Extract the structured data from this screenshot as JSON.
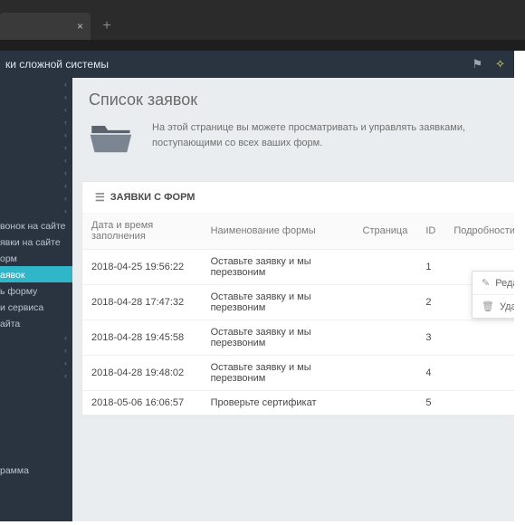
{
  "header": {
    "title": "ки сложной системы"
  },
  "page": {
    "title": "Список заявок",
    "info": "На этой странице вы можете просматривать и управлять заявками, поступающими со всех ваших форм."
  },
  "panel": {
    "title": "ЗАЯВКИ С ФОРМ"
  },
  "table": {
    "columns": {
      "datetime": "Дата и время заполнения",
      "form_name": "Наименование формы",
      "page": "Страница",
      "id": "ID",
      "details": "Подробности"
    },
    "rows": [
      {
        "datetime": "2018-04-25 19:56:22",
        "form_name": "Оставьте заявку и мы перезвоним",
        "page": "",
        "id": "1"
      },
      {
        "datetime": "2018-04-28 17:47:32",
        "form_name": "Оставьте заявку и мы перезвоним",
        "page": "",
        "id": "2"
      },
      {
        "datetime": "2018-04-28 19:45:58",
        "form_name": "Оставьте заявку и мы перезвоним",
        "page": "",
        "id": "3"
      },
      {
        "datetime": "2018-04-28 19:48:02",
        "form_name": "Оставьте заявку и мы перезвоним",
        "page": "",
        "id": "4"
      },
      {
        "datetime": "2018-05-06 16:06:57",
        "form_name": "Проверьте сертификат",
        "page": "",
        "id": "5"
      }
    ]
  },
  "context_menu": {
    "edit": "Редактирова",
    "delete": "Удалить"
  },
  "sidebar": {
    "items": [
      "вонок на сайте",
      "явки на сайте",
      "орм",
      "аявок",
      "ь форму",
      "и сервиса",
      "айта"
    ],
    "footer": "рамма"
  }
}
